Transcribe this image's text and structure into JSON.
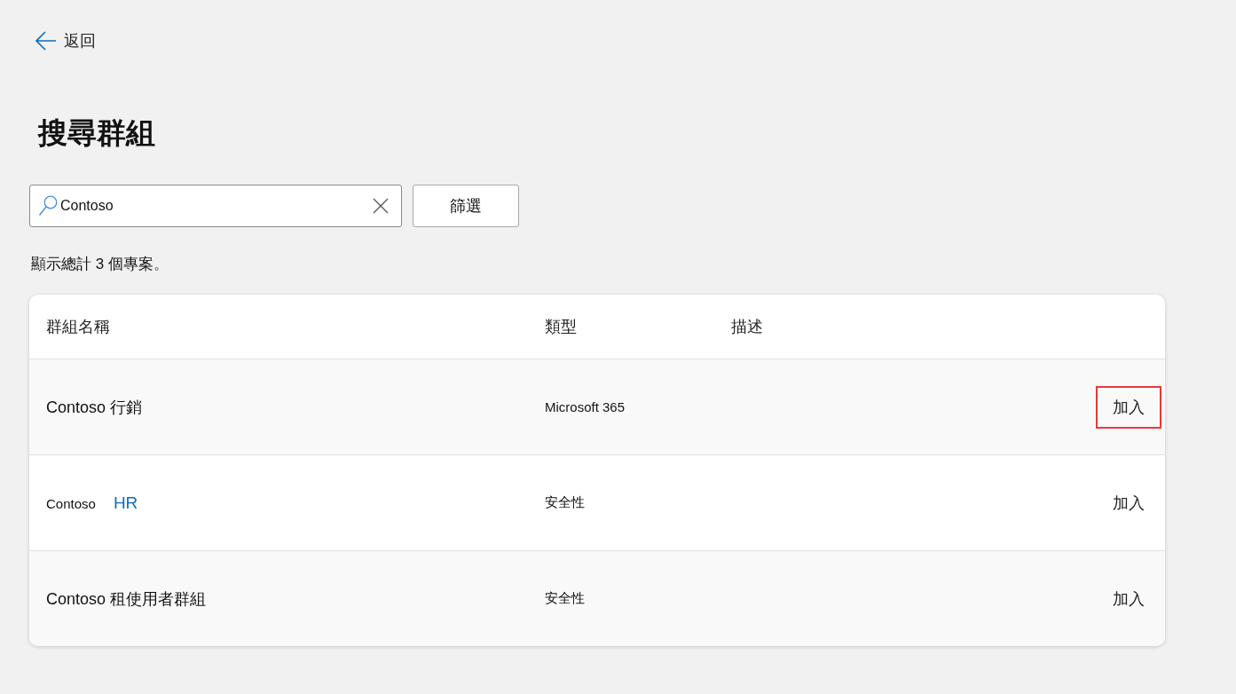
{
  "back_link": {
    "label": "返回"
  },
  "title": "搜尋群組",
  "search": {
    "value": "Contoso"
  },
  "filter_button": {
    "label": "篩選"
  },
  "result_count": "顯示總計 3 個專案。",
  "table": {
    "columns": [
      "群組名稱",
      "類型",
      "描述"
    ],
    "rows": [
      {
        "name": [
          {
            "kind": "text",
            "text": "Contoso 行銷"
          }
        ],
        "type": "Microsoft 365",
        "action": {
          "label": "加入",
          "highlighted": true
        }
      },
      {
        "name": [
          {
            "kind": "small",
            "text": "Contoso"
          },
          {
            "kind": "link",
            "text": "HR"
          }
        ],
        "type": "安全性",
        "action": {
          "label": "加入",
          "highlighted": false
        }
      },
      {
        "name": [
          {
            "kind": "text",
            "text": "Contoso 租使用者群組"
          }
        ],
        "type": "安全性",
        "action": {
          "label": "加入",
          "highlighted": false
        }
      }
    ]
  }
}
